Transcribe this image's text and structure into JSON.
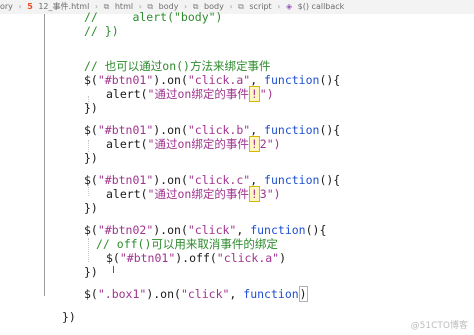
{
  "breadcrumb": {
    "items": [
      "ory",
      "12_事件.html",
      "html",
      "body",
      "body",
      "script",
      "$() callback"
    ]
  },
  "code": {
    "lines": [
      {
        "id": "l1",
        "text": "//     alert(\"body\")",
        "type": "comment"
      },
      {
        "id": "l2",
        "text": "// })",
        "type": "comment"
      },
      {
        "id": "l3",
        "text": "// 也可以通过on()方法来绑定事件",
        "type": "comment"
      },
      {
        "id": "l4a",
        "text": "$(",
        "type": "punct"
      },
      {
        "id": "l5",
        "text": "})",
        "type": "punct"
      }
    ],
    "comment_bind_on": "// 也可以通过on()方法来绑定事件",
    "btn01_sel": "\"#btn01\"",
    "btn02_sel": "\"#btn02\"",
    "box1_sel": "\".box1\"",
    "on_call": ").on(",
    "click_a": "\"click.a\"",
    "click_b": "\"click.b\"",
    "click_c": "\"click.c\"",
    "click": "\"click\"",
    "function_kw": "function",
    "fn_open": "(){",
    "alert_open": "alert(",
    "alert_text_1": "\"通过on绑定的事件",
    "alert_mark_1": "!",
    "alert_tail_1": "\")",
    "alert_text_2": "\"通过on绑定的事件",
    "alert_mark_2": "!",
    "alert_num_2": "2",
    "alert_tail_2": "\")",
    "alert_text_3": "\"通过on绑定的事件",
    "alert_mark_3": "!",
    "alert_num_3": "3",
    "alert_tail_3": "\")",
    "close_block": "})",
    "comment_off": "// off()可以用来取消事件的绑定",
    "off_call": ").off(",
    "off_arg": "\"click.a\"",
    "off_tail": ")",
    "last_tail": ")",
    "final_close": "})",
    "comment_alert_body": "//     alert(\"body\")",
    "comment_close": "// })"
  },
  "cursor_glyph": "I",
  "watermark": "@51CTO博客"
}
